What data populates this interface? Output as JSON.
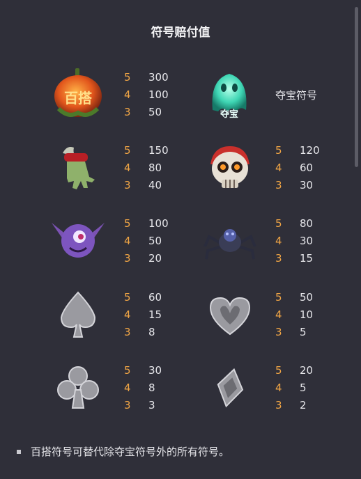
{
  "title": "符号赔付值",
  "icons": {
    "pumpkin": "pumpkin-wild-icon",
    "ghost": "ghost-treasure-icon",
    "zombie_hand": "zombie-hand-icon",
    "skull": "pirate-skull-icon",
    "bat": "bat-monster-icon",
    "spider": "spider-icon",
    "spade": "spade-icon",
    "heart": "heart-icon",
    "club": "club-icon",
    "diamond": "diamond-icon"
  },
  "pumpkin": {
    "wild_label": "百搭",
    "rows": [
      {
        "c": "5",
        "v": "300"
      },
      {
        "c": "4",
        "v": "100"
      },
      {
        "c": "3",
        "v": "50"
      }
    ]
  },
  "ghost": {
    "label": "夺宝符号",
    "badge": "夺宝"
  },
  "zombie_hand": {
    "rows": [
      {
        "c": "5",
        "v": "150"
      },
      {
        "c": "4",
        "v": "80"
      },
      {
        "c": "3",
        "v": "40"
      }
    ]
  },
  "skull": {
    "rows": [
      {
        "c": "5",
        "v": "120"
      },
      {
        "c": "4",
        "v": "60"
      },
      {
        "c": "3",
        "v": "30"
      }
    ]
  },
  "bat": {
    "rows": [
      {
        "c": "5",
        "v": "100"
      },
      {
        "c": "4",
        "v": "50"
      },
      {
        "c": "3",
        "v": "20"
      }
    ]
  },
  "spider": {
    "rows": [
      {
        "c": "5",
        "v": "80"
      },
      {
        "c": "4",
        "v": "30"
      },
      {
        "c": "3",
        "v": "15"
      }
    ]
  },
  "spade": {
    "rows": [
      {
        "c": "5",
        "v": "60"
      },
      {
        "c": "4",
        "v": "15"
      },
      {
        "c": "3",
        "v": "8"
      }
    ]
  },
  "heart": {
    "rows": [
      {
        "c": "5",
        "v": "50"
      },
      {
        "c": "4",
        "v": "10"
      },
      {
        "c": "3",
        "v": "5"
      }
    ]
  },
  "club": {
    "rows": [
      {
        "c": "5",
        "v": "30"
      },
      {
        "c": "4",
        "v": "8"
      },
      {
        "c": "3",
        "v": "3"
      }
    ]
  },
  "diamond": {
    "rows": [
      {
        "c": "5",
        "v": "20"
      },
      {
        "c": "4",
        "v": "5"
      },
      {
        "c": "3",
        "v": "2"
      }
    ]
  },
  "note": "百搭符号可替代除夺宝符号外的所有符号。",
  "colors": {
    "background": "#2f2f39",
    "count": "#f0a545",
    "text": "#e6e6ea"
  }
}
